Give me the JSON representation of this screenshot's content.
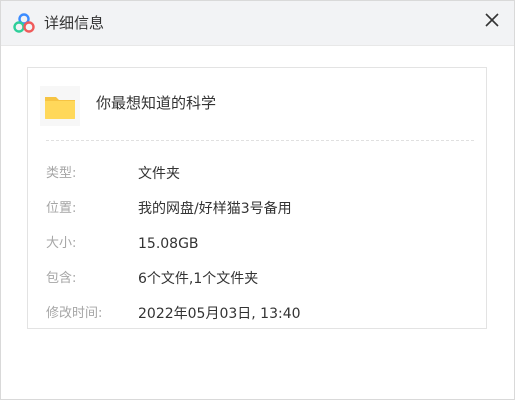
{
  "dialog": {
    "title": "详细信息",
    "accent_color": "#3c8cff"
  },
  "icons": {
    "app": "cloud-logo-icon",
    "close": "close-icon",
    "folder": "folder-icon"
  },
  "item": {
    "name": "你最想知道的科学"
  },
  "details": [
    {
      "label": "类型:",
      "value": "文件夹"
    },
    {
      "label": "位置:",
      "value": "我的网盘/好样猫3号备用"
    },
    {
      "label": "大小:",
      "value": "15.08GB"
    },
    {
      "label": "包含:",
      "value": "6个文件,1个文件夹"
    },
    {
      "label": "修改时间:",
      "value": "2022年05月03日, 13:40"
    }
  ]
}
